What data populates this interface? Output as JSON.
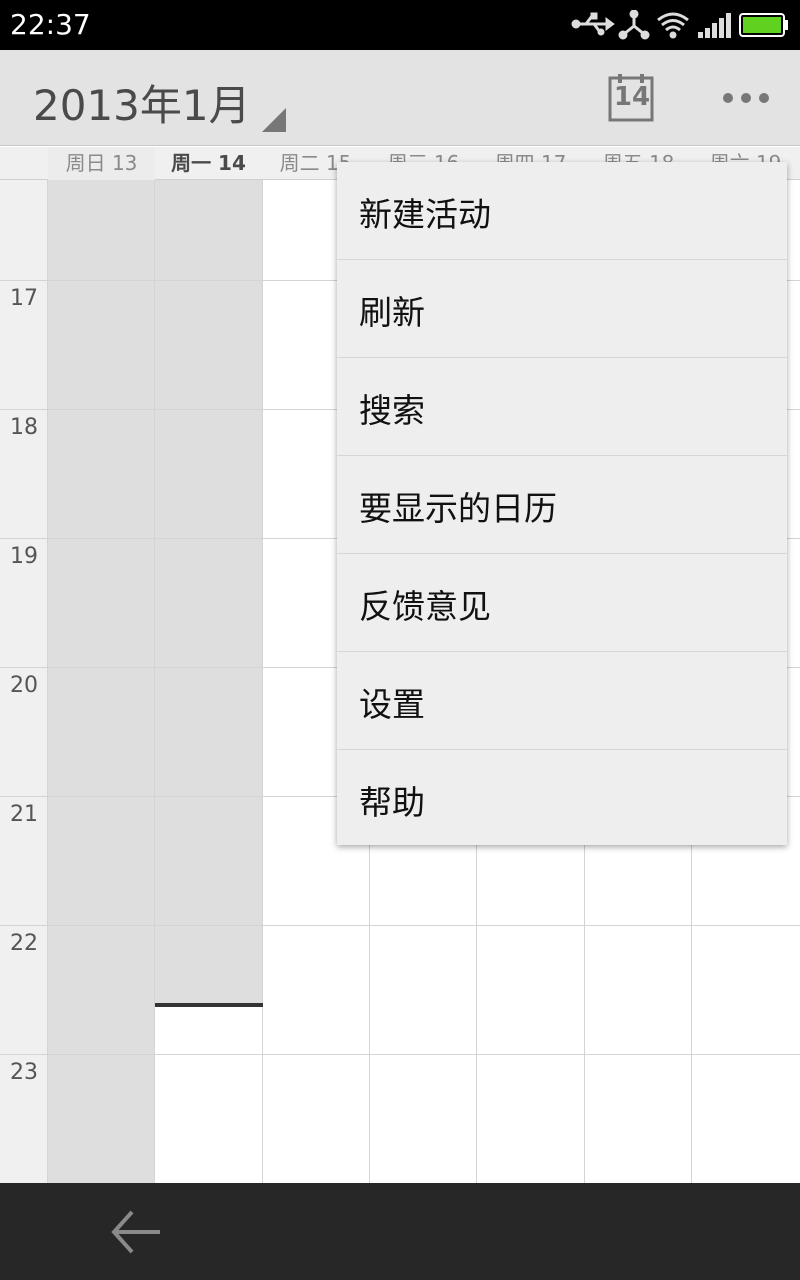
{
  "status_bar": {
    "time": "22:37",
    "icons": [
      "usb-icon",
      "share-icon",
      "wifi-icon",
      "signal-icon",
      "battery-icon"
    ],
    "battery_color": "#5fd11e"
  },
  "action_bar": {
    "title": "2013年1月",
    "today_number": "14",
    "overflow_icon": "more-dots-icon"
  },
  "week": {
    "days": [
      {
        "label": "周日 13",
        "today": false
      },
      {
        "label": "周一 14",
        "today": true
      },
      {
        "label": "周二 15",
        "today": false
      },
      {
        "label": "周三 16",
        "today": false
      },
      {
        "label": "周四 17",
        "today": false
      },
      {
        "label": "周五 18",
        "today": false
      },
      {
        "label": "周六 19",
        "today": false
      }
    ]
  },
  "hours": [
    "17",
    "18",
    "19",
    "20",
    "21",
    "22",
    "23"
  ],
  "menu": {
    "items": [
      {
        "label": "新建活动"
      },
      {
        "label": "刷新"
      },
      {
        "label": "搜索"
      },
      {
        "label": "要显示的日历"
      },
      {
        "label": "反馈意见"
      },
      {
        "label": "设置"
      },
      {
        "label": "帮助"
      }
    ]
  },
  "nav_bar": {
    "back_icon": "back-arrow-icon"
  },
  "colors": {
    "past_day_fill": "#dedede",
    "grid_line": "#d4d4d4",
    "action_bar": "#e3e3e3",
    "nav_bar": "#272727"
  }
}
